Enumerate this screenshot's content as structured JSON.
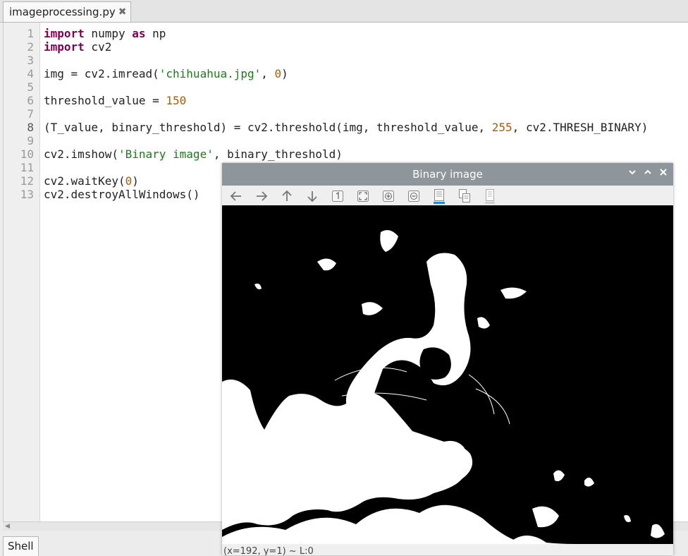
{
  "editor": {
    "tab_title": "imageprocessing.py",
    "current_line": 8,
    "lines": [
      [
        {
          "t": "import",
          "c": "kw"
        },
        {
          "t": " numpy "
        },
        {
          "t": "as",
          "c": "kw"
        },
        {
          "t": " np"
        }
      ],
      [
        {
          "t": "import",
          "c": "kw"
        },
        {
          "t": " cv2"
        }
      ],
      [],
      [
        {
          "t": "img = cv2.imread("
        },
        {
          "t": "'chihuahua.jpg'",
          "c": "str"
        },
        {
          "t": ", "
        },
        {
          "t": "0",
          "c": "num"
        },
        {
          "t": ")"
        }
      ],
      [],
      [
        {
          "t": "threshold_value = "
        },
        {
          "t": "150",
          "c": "num"
        }
      ],
      [],
      [
        {
          "t": "(T_value, binary_threshold) = cv2.threshold(img, threshold_value, "
        },
        {
          "t": "255",
          "c": "num"
        },
        {
          "t": ", cv2.THRESH_BINARY)"
        }
      ],
      [],
      [
        {
          "t": "cv2.imshow("
        },
        {
          "t": "'Binary image'",
          "c": "str"
        },
        {
          "t": ", binary_threshold)"
        }
      ],
      [],
      [
        {
          "t": "cv2.waitKey("
        },
        {
          "t": "0",
          "c": "num"
        },
        {
          "t": ")"
        }
      ],
      [
        {
          "t": "cv2.destroyAllWindows()"
        }
      ]
    ]
  },
  "shell_tab": "Shell",
  "image_window": {
    "title": "Binary image",
    "status": "(x=192, y=1) ~ L:0",
    "toolbar_icons": [
      "arrow-left-icon",
      "arrow-right-icon",
      "arrow-up-icon",
      "arrow-down-icon",
      "zoom-fit-icon",
      "zoom-original-icon",
      "zoom-in-icon",
      "zoom-out-icon",
      "save-image-icon",
      "copy-image-icon",
      "properties-icon"
    ]
  },
  "colors": {
    "keyword": "#7f0055",
    "string": "#188018",
    "number": "#b05a00",
    "titlebar": "#8f969b"
  }
}
